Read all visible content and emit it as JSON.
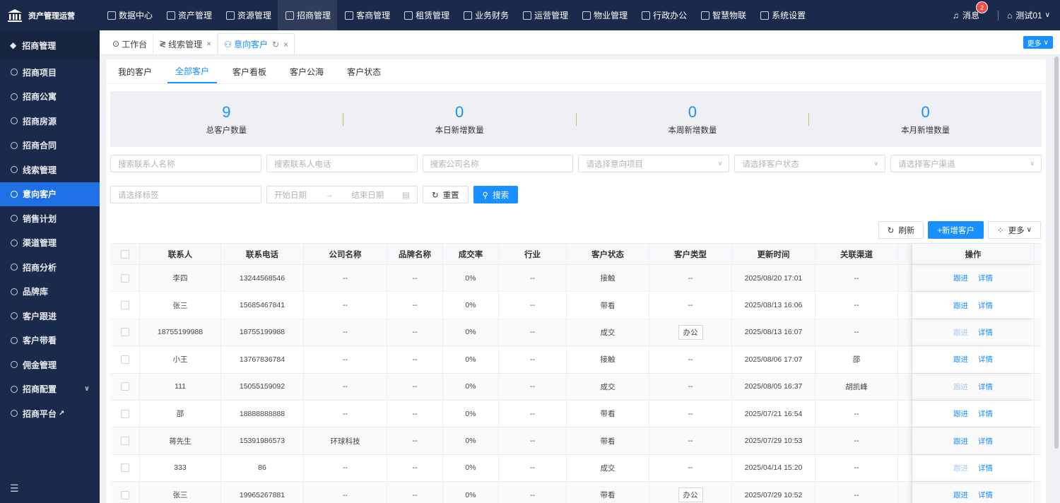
{
  "app": {
    "title": "资产管理运营"
  },
  "topnav": [
    {
      "label": "数据中心",
      "icon": "clock-icon",
      "active": false
    },
    {
      "label": "资产管理",
      "icon": "cube-icon",
      "active": false
    },
    {
      "label": "资源管理",
      "icon": "building-icon",
      "active": false
    },
    {
      "label": "招商管理",
      "icon": "tag-icon",
      "active": true
    },
    {
      "label": "客商管理",
      "icon": "users-icon",
      "active": false
    },
    {
      "label": "租赁管理",
      "icon": "home-icon",
      "active": false
    },
    {
      "label": "业务财务",
      "icon": "yen-icon",
      "active": false
    },
    {
      "label": "运营管理",
      "icon": "chart-icon",
      "active": false
    },
    {
      "label": "物业管理",
      "icon": "house-icon",
      "active": false
    },
    {
      "label": "行政办公",
      "icon": "monitor-icon",
      "active": false
    },
    {
      "label": "智慧物联",
      "icon": "iot-icon",
      "active": false
    },
    {
      "label": "系统设置",
      "icon": "gear-icon",
      "active": false
    }
  ],
  "topright": {
    "messages_label": "消息",
    "messages_count": "2",
    "user_label": "测试01"
  },
  "sidebar": {
    "header": "招商管理",
    "items": [
      {
        "label": "招商项目",
        "icon": "project-icon",
        "active": false
      },
      {
        "label": "招商公寓",
        "icon": "apartment-icon",
        "active": false
      },
      {
        "label": "招商房源",
        "icon": "house-icon",
        "active": false
      },
      {
        "label": "招商合同",
        "icon": "contract-icon",
        "active": false
      },
      {
        "label": "线索管理",
        "icon": "lead-icon",
        "active": false
      },
      {
        "label": "意向客户",
        "icon": "customer-icon",
        "active": true
      },
      {
        "label": "销售计划",
        "icon": "plan-icon",
        "active": false
      },
      {
        "label": "渠道管理",
        "icon": "channel-icon",
        "active": false
      },
      {
        "label": "招商分析",
        "icon": "analysis-icon",
        "active": false
      },
      {
        "label": "品牌库",
        "icon": "brand-icon",
        "active": false
      },
      {
        "label": "客户跟进",
        "icon": "follow-icon",
        "active": false
      },
      {
        "label": "客户带看",
        "icon": "visit-icon",
        "active": false
      },
      {
        "label": "佣金管理",
        "icon": "commission-icon",
        "active": false
      },
      {
        "label": "招商配置",
        "icon": "config-icon",
        "active": false,
        "expandable": true
      },
      {
        "label": "招商平台",
        "icon": "platform-icon",
        "active": false,
        "external": true
      }
    ]
  },
  "tabs": [
    {
      "label": "工作台",
      "active": false,
      "closable": false
    },
    {
      "label": "线索管理",
      "active": false,
      "closable": true
    },
    {
      "label": "意向客户",
      "active": true,
      "closable": true
    }
  ],
  "tabbar_more": "更多",
  "subtabs": [
    {
      "label": "我的客户",
      "active": false
    },
    {
      "label": "全部客户",
      "active": true
    },
    {
      "label": "客户看板",
      "active": false
    },
    {
      "label": "客户公海",
      "active": false
    },
    {
      "label": "客户状态",
      "active": false
    }
  ],
  "stats": [
    {
      "value": "9",
      "label": "总客户数量"
    },
    {
      "value": "0",
      "label": "本日新增数量"
    },
    {
      "value": "0",
      "label": "本周新增数量"
    },
    {
      "value": "0",
      "label": "本月新增数量"
    }
  ],
  "filters": {
    "contact_name": "搜索联系人名称",
    "contact_phone": "搜索联系人电话",
    "company_name": "搜索公司名称",
    "project": "请选择意向项目",
    "status": "请选择客户状态",
    "channel": "请选择客户渠道",
    "tags": "请选择标签",
    "start_date": "开始日期",
    "end_date": "结束日期",
    "reset": "重置",
    "search": "搜索"
  },
  "actions": {
    "refresh": "刷新",
    "add": "+新增客户",
    "more": "更多"
  },
  "table": {
    "headers": [
      "联系人",
      "联系电话",
      "公司名称",
      "品牌名称",
      "成交率",
      "行业",
      "客户状态",
      "客户类型",
      "更新时间",
      "关联渠道",
      "",
      "操作"
    ],
    "rows": [
      {
        "contact": "李四",
        "phone": "13244568546",
        "company": "--",
        "brand": "--",
        "rate": "0%",
        "industry": "--",
        "status": "接触",
        "type": "--",
        "type_tag": false,
        "updated": "2025/08/20 17:01",
        "channel": "--",
        "follow": "跟进",
        "follow_disabled": false,
        "detail": "详情"
      },
      {
        "contact": "张三",
        "phone": "15685467841",
        "company": "--",
        "brand": "--",
        "rate": "0%",
        "industry": "--",
        "status": "带看",
        "type": "--",
        "type_tag": false,
        "updated": "2025/08/13 16:06",
        "channel": "--",
        "follow": "跟进",
        "follow_disabled": false,
        "detail": "详情"
      },
      {
        "contact": "18755199988",
        "phone": "18755199988",
        "company": "--",
        "brand": "--",
        "rate": "0%",
        "industry": "--",
        "status": "成交",
        "type": "办公",
        "type_tag": true,
        "updated": "2025/08/13 16:07",
        "channel": "--",
        "follow": "跟进",
        "follow_disabled": true,
        "detail": "详情"
      },
      {
        "contact": "小王",
        "phone": "13767836784",
        "company": "--",
        "brand": "--",
        "rate": "0%",
        "industry": "--",
        "status": "接触",
        "type": "--",
        "type_tag": false,
        "updated": "2025/08/06 17:07",
        "channel": "邵",
        "follow": "跟进",
        "follow_disabled": false,
        "detail": "详情"
      },
      {
        "contact": "111",
        "phone": "15055159092",
        "company": "--",
        "brand": "--",
        "rate": "0%",
        "industry": "--",
        "status": "成交",
        "type": "--",
        "type_tag": false,
        "updated": "2025/08/05 16:37",
        "channel": "胡凯峰",
        "follow": "跟进",
        "follow_disabled": true,
        "detail": "详情"
      },
      {
        "contact": "邵",
        "phone": "18888888888",
        "company": "--",
        "brand": "--",
        "rate": "0%",
        "industry": "--",
        "status": "带看",
        "type": "--",
        "type_tag": false,
        "updated": "2025/07/21 16:54",
        "channel": "--",
        "follow": "跟进",
        "follow_disabled": false,
        "detail": "详情"
      },
      {
        "contact": "蒋先生",
        "phone": "15391986573",
        "company": "环球科技",
        "brand": "--",
        "rate": "0%",
        "industry": "--",
        "status": "带看",
        "type": "--",
        "type_tag": false,
        "updated": "2025/07/29 10:53",
        "channel": "--",
        "follow": "跟进",
        "follow_disabled": false,
        "detail": "详情"
      },
      {
        "contact": "333",
        "phone": "86",
        "company": "--",
        "brand": "--",
        "rate": "0%",
        "industry": "--",
        "status": "成交",
        "type": "--",
        "type_tag": false,
        "updated": "2025/04/14 15:20",
        "channel": "--",
        "follow": "跟进",
        "follow_disabled": true,
        "detail": "详情"
      },
      {
        "contact": "张三",
        "phone": "19965267881",
        "company": "--",
        "brand": "--",
        "rate": "0%",
        "industry": "--",
        "status": "带看",
        "type": "办公",
        "type_tag": true,
        "updated": "2025/07/29 10:52",
        "channel": "--",
        "follow": "跟进",
        "follow_disabled": false,
        "detail": "详情"
      }
    ]
  },
  "colors": {
    "primary": "#1890ff",
    "sidebar_bg": "#1b2a4a",
    "active_blue": "#1f6fe5"
  }
}
